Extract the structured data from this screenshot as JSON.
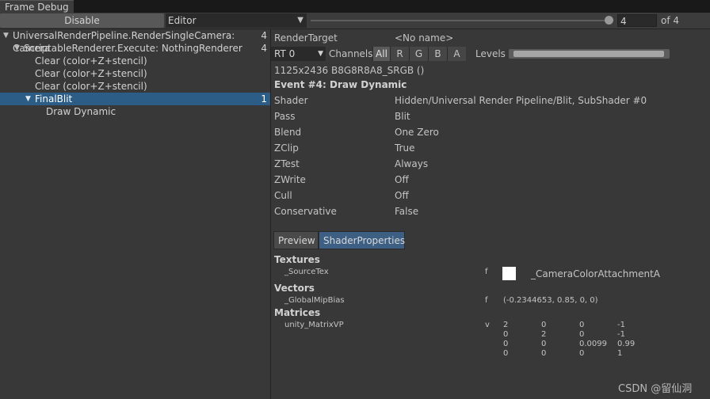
{
  "window": {
    "tab_title": "Frame Debug"
  },
  "toolbar": {
    "disable_label": "Disable",
    "target_value": "Editor",
    "event_value": "4",
    "event_total": "of 4",
    "slider_level": 1.0
  },
  "tree": {
    "rows": [
      {
        "label": "UniversalRenderPipeline.RenderSingleCamera: Camera",
        "count": "4"
      },
      {
        "label": "ScriptableRenderer.Execute: NothingRenderer",
        "count": "4"
      },
      {
        "label": "Clear (color+Z+stencil)",
        "count": ""
      },
      {
        "label": "Clear (color+Z+stencil)",
        "count": ""
      },
      {
        "label": "Clear (color+Z+stencil)",
        "count": ""
      },
      {
        "label": "FinalBlit",
        "count": "1"
      },
      {
        "label": "Draw Dynamic",
        "count": ""
      }
    ]
  },
  "details": {
    "render_target_label": "RenderTarget",
    "render_target_value": "<No name>",
    "rt_select": "RT 0",
    "channels_label": "Channels",
    "channels": [
      "All",
      "R",
      "G",
      "B",
      "A"
    ],
    "levels_label": "Levels",
    "format": "1125x2436 B8G8R8A8_SRGB ()",
    "event_title": "Event #4: Draw Dynamic",
    "props": [
      {
        "label": "Shader",
        "value": "Hidden/Universal Render Pipeline/Blit, SubShader #0"
      },
      {
        "label": "Pass",
        "value": "Blit"
      },
      {
        "label": "Blend",
        "value": "One Zero"
      },
      {
        "label": "ZClip",
        "value": "True"
      },
      {
        "label": "ZTest",
        "value": "Always"
      },
      {
        "label": "ZWrite",
        "value": "Off"
      },
      {
        "label": "Cull",
        "value": "Off"
      },
      {
        "label": "Conservative",
        "value": "False"
      }
    ],
    "tabs": {
      "preview": "Preview",
      "shader_properties": "ShaderProperties"
    },
    "textures": {
      "header": "Textures",
      "name": "_SourceTex",
      "stage": "f",
      "value": "_CameraColorAttachmentA",
      "swatch_color": "#ffffff"
    },
    "vectors": {
      "header": "Vectors",
      "name": "_GlobalMipBias",
      "stage": "f",
      "value": "(-0.2344653, 0.85, 0, 0)"
    },
    "matrices": {
      "header": "Matrices",
      "name": "unity_MatrixVP",
      "stage": "v",
      "rows": [
        [
          "2",
          "0",
          "0",
          "-1"
        ],
        [
          "0",
          "2",
          "0",
          "-1"
        ],
        [
          "0",
          "0",
          "0.0099",
          "0.99"
        ],
        [
          "0",
          "0",
          "0",
          "1"
        ]
      ]
    }
  },
  "watermark": "CSDN @留仙洞",
  "colors": {
    "selection": "#2c5d87",
    "active_tab": "#3e5f84",
    "background": "#383838"
  }
}
